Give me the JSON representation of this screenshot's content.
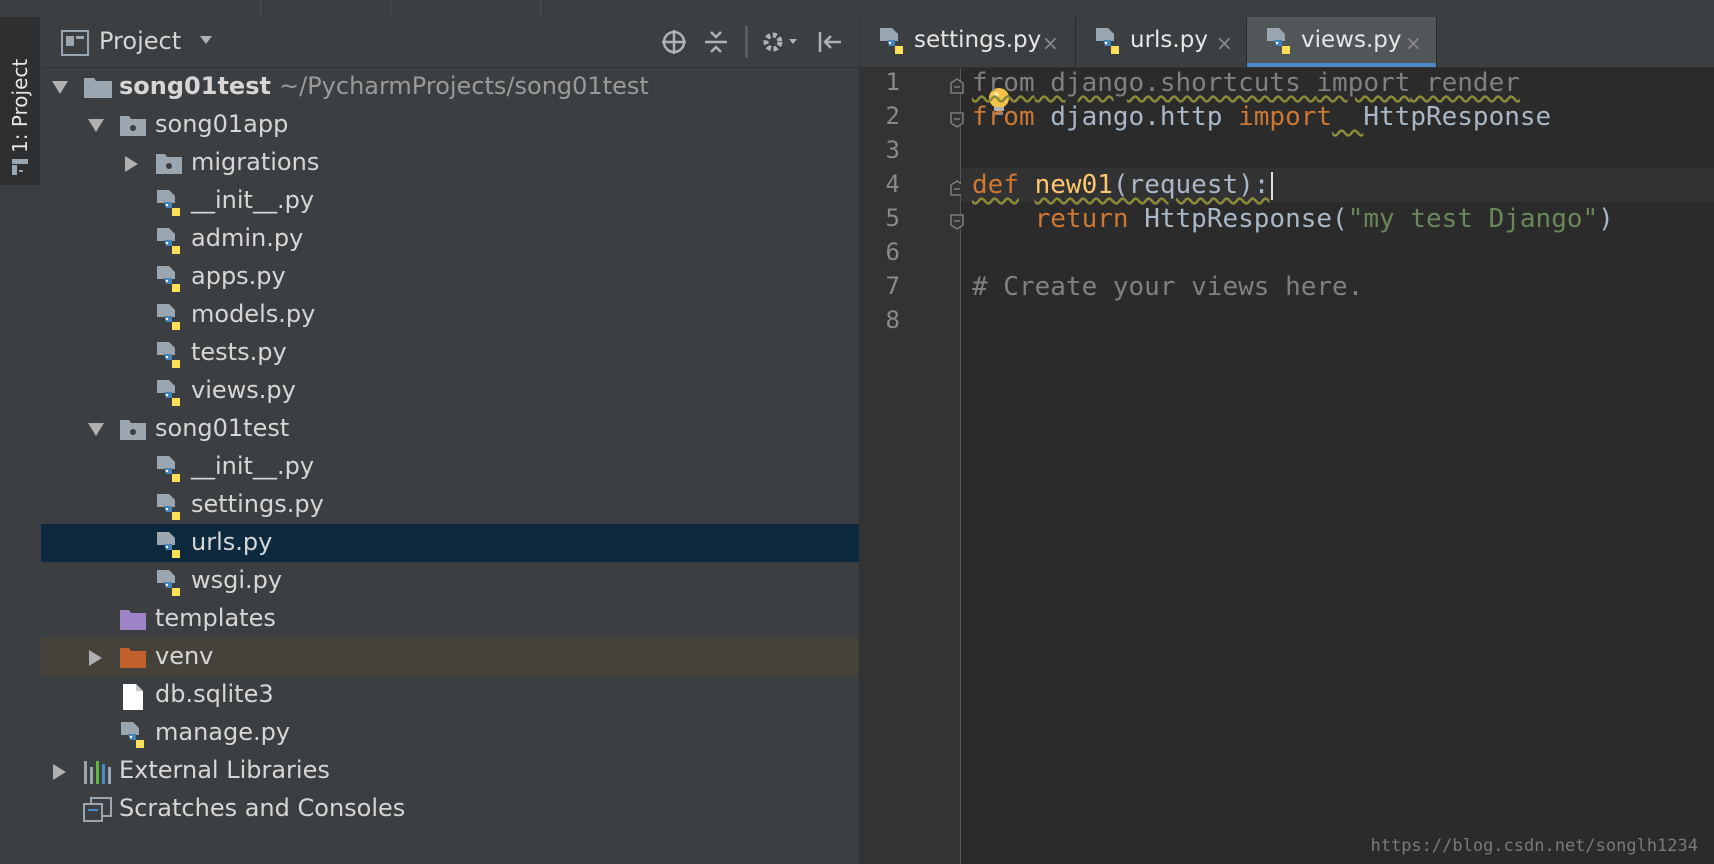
{
  "tool_window": {
    "tab_label": "1: Project"
  },
  "project_panel": {
    "title": "Project",
    "tree": [
      {
        "label": "song01test",
        "path": "~/PycharmProjects/song01test"
      },
      {
        "label": "song01app"
      },
      {
        "label": "migrations"
      },
      {
        "label": "__init__.py"
      },
      {
        "label": "admin.py"
      },
      {
        "label": "apps.py"
      },
      {
        "label": "models.py"
      },
      {
        "label": "tests.py"
      },
      {
        "label": "views.py"
      },
      {
        "label": "song01test"
      },
      {
        "label": "__init__.py"
      },
      {
        "label": "settings.py"
      },
      {
        "label": "urls.py"
      },
      {
        "label": "wsgi.py"
      },
      {
        "label": "templates"
      },
      {
        "label": "venv"
      },
      {
        "label": "db.sqlite3"
      },
      {
        "label": "manage.py"
      },
      {
        "label": "External Libraries"
      },
      {
        "label": "Scratches and Consoles"
      }
    ]
  },
  "editor": {
    "tabs": [
      {
        "label": "settings.py",
        "close": "×"
      },
      {
        "label": "urls.py",
        "close": "×"
      },
      {
        "label": "views.py",
        "close": "×"
      }
    ],
    "line_numbers": [
      "1",
      "2",
      "3",
      "4",
      "5",
      "6",
      "7",
      "8"
    ],
    "code": {
      "l1_from": "from",
      "l1_module": " django.shortcuts ",
      "l1_import": "import",
      "l1_name": " render",
      "l2_from": "from",
      "l2_module": " django.http ",
      "l2_import": "import",
      "l2_gap": "  ",
      "l2_name": "HttpResponse",
      "l4_def": "def",
      "l4_space": " ",
      "l4_fn": "new01",
      "l4_params": "(request):",
      "l5_indent": "    ",
      "l5_return": "return",
      "l5_call": " HttpResponse(",
      "l5_str": "\"my test Django\"",
      "l5_close": ")",
      "l7_comment": "# Create your views here."
    }
  },
  "watermark": "https://blog.csdn.net/songlh1234"
}
